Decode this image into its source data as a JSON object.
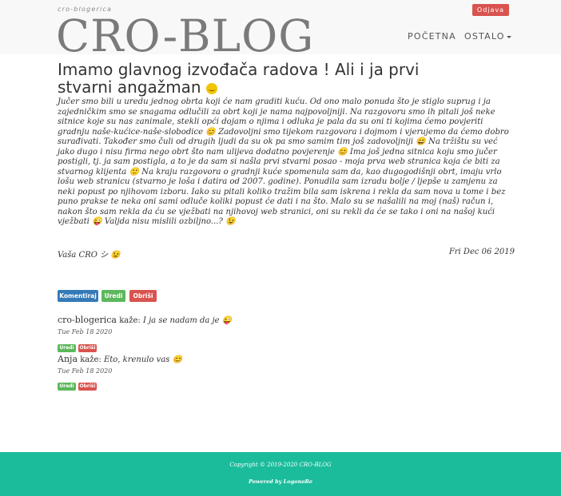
{
  "header": {
    "site_subtitle": "cro-blogerica",
    "brand": "CRO-BLOG",
    "logout_label": "Odjava",
    "nav": {
      "home": "POČETNA",
      "other": "OSTALO"
    }
  },
  "post": {
    "title": "Imamo glavnog izvođača radova ! Ali i ja prvi stvarni angažman",
    "body": "Jučer smo bili u uredu jednog obrta koji će nam graditi kuću. Od ono malo ponuda što je stiglo suprug i ja zajedničkim smo se snagama odlučili za obrt koji je nama najpovoljniji. Na razgovoru smo ih pitali još neke sitnice koje su nas zanimale, stekli opći dojam o njima i odluka je pala da su oni ti kojima ćemo povjeriti gradnju naše-kućice-naše-slobodice 😊 Zadovoljni smo tijekom razgovora i dojmom i vjerujemo da ćemo dobro surađivati. Također smo čuli od drugih ljudi da su ok pa smo samim tim još zadovoljniji 😄 Na tržištu su već jako dugo i nisu firma nego obrt što nam ulijeva dodatno povjerenje 😊 Ima još jedna sitnica koju smo jučer postigli, tj. ja sam postigla, a to je da sam si našla prvi stvarni posao - moja prva web stranica koja će biti za stvarnog klijenta 🙂 Na kraju razgovora o gradnji kuće spomenula sam da, kao dugogodišnji obrt, imaju vrlo lošu web stranicu (stvarno je loša i datira od 2007. godine). Ponudila sam izradu bolje / ljepše u zamjenu za neki popust po njihovom izboru. Iako su pitali koliko tražim bila sam iskrena i rekla da sam nova u tome i bez puno prakse te neka oni sami odluče koliki popust će dati i na što. Malo su se našalili na moj (naš) račun i, nakon što sam rekla da ću se vježbati na njihovoj web stranici, oni su rekli da će se tako i oni na našoj kući vježbati 😜 Valjda nisu mislili ozbiljno...? 😉",
    "signature": "Vaša CRO シ 😉",
    "date": "Fri Dec 06 2019"
  },
  "actions": {
    "comment": "Komentiraj",
    "edit": "Uredi",
    "delete": "Obriši"
  },
  "comments": [
    {
      "author": "cro-blogerica",
      "says": "kaže:",
      "text": "I ja se nadam da je 😜",
      "date": "Tue Feb 18 2020",
      "edit": "Uredi",
      "delete": "Obriši"
    },
    {
      "author": "Anja",
      "says": "kaže:",
      "text": "Eto, krenulo vas 😊",
      "date": "Tue Feb 18 2020",
      "edit": "Uredi",
      "delete": "Obriši"
    }
  ],
  "footer": {
    "copyright": "Copyright © 2019-2020 CRO-BLOG",
    "powered": "Powered by LogonoRe"
  },
  "colors": {
    "footer": "#1abc9c",
    "primary": "#337ab7",
    "success": "#5cb85c",
    "danger": "#d9534f"
  }
}
